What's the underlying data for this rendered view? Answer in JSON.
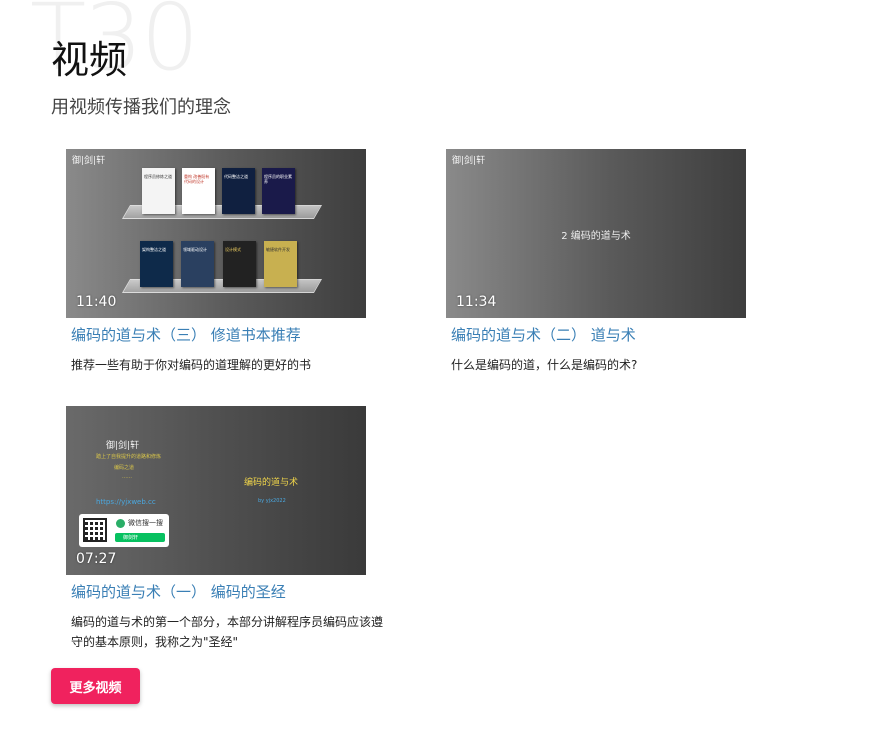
{
  "background_word": "T30",
  "section": {
    "title": "视频",
    "subtitle": "用视频传播我们的理念"
  },
  "videos": [
    {
      "thumb_logo": "御|剑|轩",
      "duration": "11:40",
      "title": "编码的道与术（三） 修道书本推荐",
      "description": "推荐一些有助于你对编码的道理解的更好的书",
      "books": [
        {
          "title": "程序员修炼之道",
          "color": "#f4f4f4",
          "text_color": "#333"
        },
        {
          "title": "重构 改善既有代码的设计",
          "color": "#ffffff",
          "text_color": "#c0392b"
        },
        {
          "title": "代码整洁之道",
          "color": "#102040",
          "text_color": "#ffffff"
        },
        {
          "title": "程序员的职业素养",
          "color": "#1a1a4a",
          "text_color": "#ffffff"
        },
        {
          "title": "架构整洁之道",
          "color": "#0e2a4a",
          "text_color": "#ffffff"
        },
        {
          "title": "领域驱动设计",
          "color": "#2a4060",
          "text_color": "#ffffff"
        },
        {
          "title": "设计模式",
          "color": "#222222",
          "text_color": "#f0d060"
        },
        {
          "title": "敏捷软件开发",
          "color": "#c8b050",
          "text_color": "#333"
        }
      ]
    },
    {
      "thumb_logo": "御|剑|轩",
      "duration": "11:34",
      "center_caption": "2 编码的道与术",
      "title": "编码的道与术（二） 道与术",
      "description": "什么是编码的道，什么是编码的术?"
    },
    {
      "thumb_logo": "御|剑|轩",
      "duration": "07:27",
      "title": "编码的道与术（一） 编码的圣经",
      "description": "编码的道与术的第一个部分，本部分讲解程序员编码应该遵守的基本原则，我称之为\"圣经\"",
      "thumb_text": {
        "logo": "御|剑|轩",
        "yellow_line_1": "踏上了自我提升的道路和修炼",
        "yellow_line_2": "编码之道",
        "yellow_line_3": "……",
        "title": "编码的道与术",
        "url": "https://yjxweb.cc",
        "small": "by yjx2022",
        "wechat_label": "微信搜一搜",
        "wechat_search": "御剑轩"
      }
    }
  ],
  "more_button": "更多视频",
  "colors": {
    "accent": "#f0225e",
    "link": "#3a7fb5"
  }
}
